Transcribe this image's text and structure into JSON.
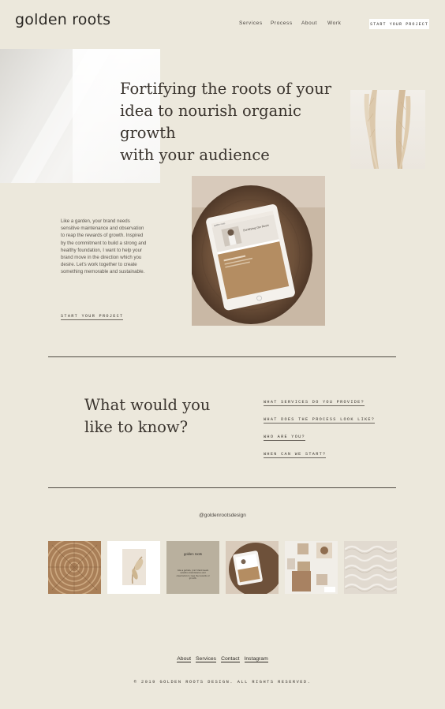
{
  "brand": {
    "logo": "golden roots"
  },
  "nav": {
    "items": [
      "Services",
      "Process",
      "About",
      "Work"
    ],
    "cta": "START YOUR PROJECT"
  },
  "hero": {
    "title_lines": [
      "Fortifying the roots of your",
      "idea to nourish organic growth",
      "with your audience"
    ]
  },
  "intro": {
    "body": "Like a garden, your brand needs sensitive maintenance and observation to reap the rewards of growth. Inspired by the commitment to build a strong and healthy foundation, I want to help your brand move in the direction which you desire. Let's work together to create something memorable and sustainable.",
    "cta": "START YOUR PROJECT"
  },
  "tablet_screen": {
    "header": "golden roots",
    "headline": "Fortifying the Roots"
  },
  "faq": {
    "title_lines": [
      "What would you",
      "like to know?"
    ],
    "questions": [
      "WHAT SERVICES DO YOU PROVIDE?",
      "WHAT DOES THE PROCESS LOOK LIKE?",
      "WHO ARE YOU?",
      "WHEN CAN WE START?"
    ]
  },
  "instagram": {
    "handle": "@goldenrootsdesign",
    "tile3_logo": "golden roots",
    "tile3_text": "Like a garden, your brand needs sensitive maintenance and observation to reap the rewards of growth."
  },
  "footer": {
    "links": [
      "About",
      "Services",
      "Contact",
      "Instagram"
    ],
    "copyright": "© 2019 GOLDEN ROOTS DESIGN. ALL RIGHTS RESERVED."
  },
  "colors": {
    "background": "#ece8dc",
    "text": "#3a342e",
    "accent_brown": "#b48d62",
    "rule": "#4e4942"
  }
}
